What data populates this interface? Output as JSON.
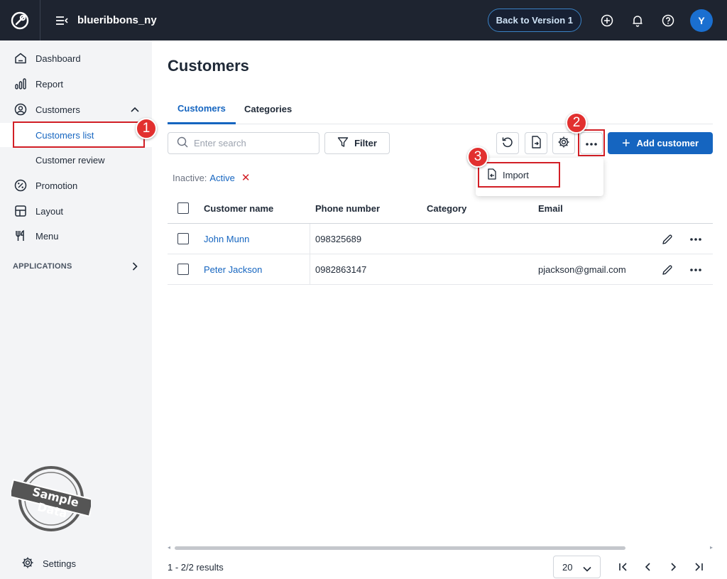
{
  "header": {
    "store_name": "blueribbons_ny",
    "back_button": "Back to Version 1",
    "avatar_initial": "Y"
  },
  "sidebar": {
    "items": [
      {
        "label": "Dashboard",
        "icon": "home-icon"
      },
      {
        "label": "Report",
        "icon": "chart-icon"
      },
      {
        "label": "Customers",
        "icon": "user-circle-icon"
      },
      {
        "label": "Promotion",
        "icon": "percent-icon"
      },
      {
        "label": "Layout",
        "icon": "layout-icon"
      },
      {
        "label": "Menu",
        "icon": "utensils-icon"
      }
    ],
    "customers_sub": [
      "Customers list",
      "Customer review"
    ],
    "applications_label": "APPLICATIONS",
    "settings_label": "Settings",
    "stamp_text": "Sample Data"
  },
  "annotations": {
    "one": "1",
    "two": "2",
    "three": "3"
  },
  "main": {
    "title": "Customers",
    "tabs": [
      "Customers",
      "Categories"
    ],
    "search_placeholder": "Enter search",
    "filter_label": "Filter",
    "add_label": "Add customer",
    "dropdown_item": "Import",
    "inactive_label": "Inactive:",
    "inactive_value": "Active",
    "columns": [
      "Customer name",
      "Phone number",
      "Category",
      "Email"
    ],
    "rows": [
      {
        "name": "John Munn",
        "phone": "098325689",
        "category": "",
        "email": ""
      },
      {
        "name": "Peter Jackson",
        "phone": "0982863147",
        "category": "",
        "email": "pjackson@gmail.com"
      }
    ],
    "results": "1 - 2/2 results",
    "page_size": "20"
  },
  "colors": {
    "accent": "#1565c0",
    "topbar": "#1e2430",
    "annotation": "#e2302f"
  }
}
